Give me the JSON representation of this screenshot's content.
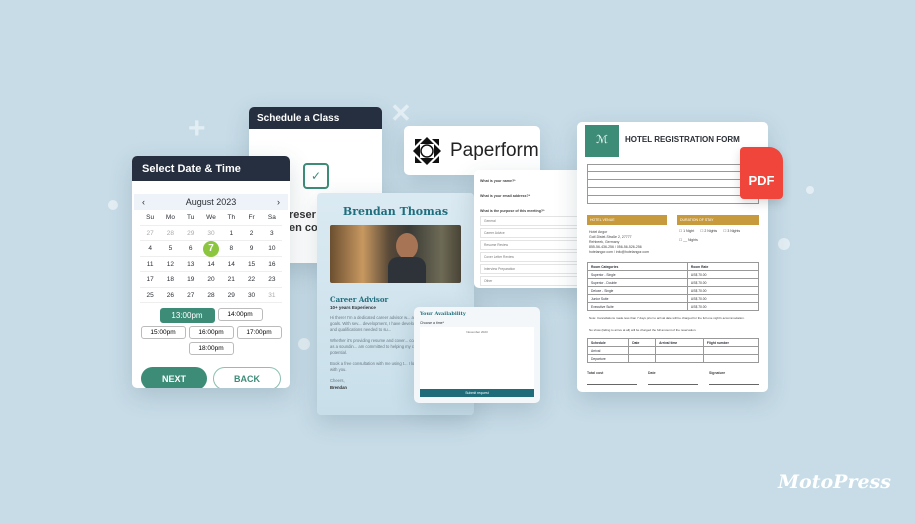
{
  "schedule": {
    "title": "Schedule a Class",
    "text_line1": "reser",
    "text_line2": "en co",
    "icon": "calendar-check-icon"
  },
  "date_picker": {
    "title": "Select Date & Time",
    "month": "August 2023",
    "prev": "‹",
    "next_arrow": "›",
    "weekdays": [
      "Su",
      "Mo",
      "Tu",
      "We",
      "Th",
      "Fr",
      "Sa"
    ],
    "days": [
      [
        "27",
        "28",
        "29",
        "30",
        "1",
        "2",
        "3"
      ],
      [
        "4",
        "5",
        "6",
        "7",
        "8",
        "9",
        "10"
      ],
      [
        "11",
        "12",
        "13",
        "14",
        "14",
        "15",
        "16"
      ],
      [
        "17",
        "18",
        "19",
        "20",
        "21",
        "22",
        "23"
      ],
      [
        "25",
        "26",
        "27",
        "28",
        "29",
        "30",
        "31"
      ]
    ],
    "selected_day": "7",
    "times": [
      "13:00pm",
      "14:00pm",
      "15:00pm",
      "16:00pm",
      "17:00pm",
      "18:00pm"
    ],
    "selected_time": "13:00pm",
    "next_label": "NEXT",
    "back_label": "BACK",
    "accent": "#3d8c78",
    "selected_color": "#8cc63f"
  },
  "paperform": {
    "name": "Paperform"
  },
  "profile": {
    "name": "Brendan Thomas",
    "role": "Career Advisor",
    "experience": "10+ years Experience",
    "p1": "Hi there! I'm a dedicated career advisor w... achieve their professional goals. With sev... development, I have developed a deep u... the skills and qualifications needed to su...",
    "p2": "Whether it's providing resume and cover... coaching, or simply serving as a soundin... am committed to helping my clients hav... their full potential.",
    "p3": "Book a free consultation with me using t... I look forward to chatting with you.",
    "sign1": "Cheers,",
    "sign2": "Brendan"
  },
  "form": {
    "q1": "What is your name?*",
    "q2": "What is your email address?*",
    "q3": "What is the purpose of this meeting?*",
    "options": [
      "General",
      "Career Advice",
      "Resume Review",
      "Cover Letter Review",
      "Interview Preparation",
      "Other"
    ]
  },
  "availability": {
    "title": "Your Availability",
    "label": "Choose a time*",
    "month": "November 2023",
    "submit": "Submit request"
  },
  "hotel": {
    "title": "HOTEL REGISTRATION FORM",
    "venue_header": "HOTEL VENUE",
    "duration_header": "DURATION OF STAY",
    "durations": [
      "1 Night",
      "2 Nights",
      "3 Nights",
      "__ Nights"
    ],
    "address": [
      "Hotel Angor",
      "Golf-Distel-Straße 2, 27777",
      "Rehbeek, Germany",
      "855-56-436-256 / 056-56-526-256",
      "hotelangor.com / info@hotelangor.com"
    ],
    "room_header": [
      "Room Categories",
      "Room Rate"
    ],
    "rooms": [
      [
        "Superior - Single",
        "US$ 70.00"
      ],
      [
        "Superior - Double",
        "US$ 70.00"
      ],
      [
        "Deluxe - Single",
        "US$ 70.00"
      ],
      [
        "Junior Suite",
        "US$ 70.00"
      ],
      [
        "Executive Suite",
        "US$ 70.00"
      ]
    ],
    "note": "Note: Cancellations made less than 7 days prior to arrival date will be charged for the full one night's accommodation.",
    "noshow": "No show (failing to arrive at all) will be charged the full amount of the reservation.",
    "sched_header": [
      "Schedule",
      "Date",
      "Arrival time",
      "Flight number"
    ],
    "sched_rows": [
      "Arrival",
      "Departure"
    ],
    "footer": [
      "Total cost",
      "Date",
      "Signature"
    ],
    "accent": "#c89a3e"
  },
  "pdf_badge": "PDF",
  "brand": "MotoPress"
}
